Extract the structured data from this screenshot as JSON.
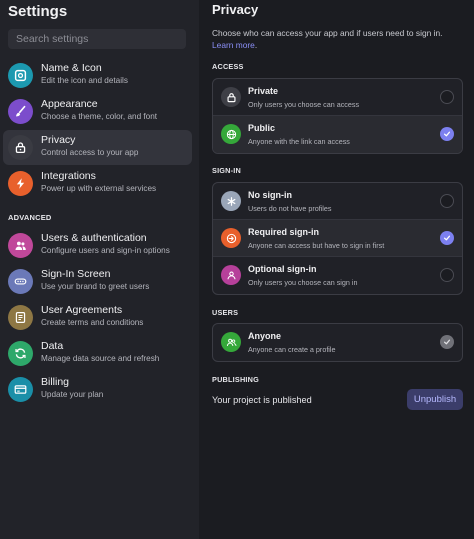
{
  "sidebar": {
    "title": "Settings",
    "search_placeholder": "Search settings",
    "items": [
      {
        "label": "Name & Icon",
        "desc": "Edit the icon and details",
        "icon": "image-icon",
        "color": "#1c99b0"
      },
      {
        "label": "Appearance",
        "desc": "Choose a theme, color, and font",
        "icon": "brush-icon",
        "color": "#7c4dcc"
      },
      {
        "label": "Privacy",
        "desc": "Control access to your app",
        "icon": "lock-icon",
        "color": "#3a3b42"
      },
      {
        "label": "Integrations",
        "desc": "Power up with external services",
        "icon": "bolt-icon",
        "color": "#e8602c"
      }
    ],
    "advanced_label": "ADVANCED",
    "advanced_items": [
      {
        "label": "Users & authentication",
        "desc": "Configure users and sign-in options",
        "icon": "users-icon",
        "color": "#c0489a"
      },
      {
        "label": "Sign-In Screen",
        "desc": "Use your brand to greet users",
        "icon": "signin-screen-icon",
        "color": "#6b79b8"
      },
      {
        "label": "User Agreements",
        "desc": "Create terms and conditions",
        "icon": "document-icon",
        "color": "#8e7744"
      },
      {
        "label": "Data",
        "desc": "Manage data source and refresh",
        "icon": "refresh-icon",
        "color": "#2ea86a"
      },
      {
        "label": "Billing",
        "desc": "Update your plan",
        "icon": "card-icon",
        "color": "#1a8fa8"
      }
    ]
  },
  "main": {
    "title": "Privacy",
    "description": "Choose who can access your app and if users need to sign in. ",
    "learn_more": "Learn more",
    "learn_more_end": ".",
    "access": {
      "heading": "ACCESS",
      "options": [
        {
          "label": "Private",
          "desc": "Only users you choose can access",
          "icon": "lock-icon",
          "color": "#3e3f46",
          "selected": false
        },
        {
          "label": "Public",
          "desc": "Anyone with the link can access",
          "icon": "globe-icon",
          "color": "#35a83a",
          "selected": true
        }
      ]
    },
    "signin": {
      "heading": "SIGN-IN",
      "options": [
        {
          "label": "No sign-in",
          "desc": "Users do not have profiles",
          "icon": "asterisk-icon",
          "color": "#9aa6b8",
          "selected": false
        },
        {
          "label": "Required sign-in",
          "desc": "Anyone can access but have to sign in first",
          "icon": "signin-icon",
          "color": "#e8602c",
          "selected": true
        },
        {
          "label": "Optional sign-in",
          "desc": "Only users you choose can sign in",
          "icon": "user-icon",
          "color": "#b6409a",
          "selected": false
        }
      ]
    },
    "users": {
      "heading": "USERS",
      "options": [
        {
          "label": "Anyone",
          "desc": "Anyone can create a profile",
          "icon": "users-icon",
          "color": "#35a83a",
          "selected": true
        }
      ]
    },
    "publishing": {
      "heading": "PUBLISHING",
      "status": "Your project is published",
      "button": "Unpublish"
    }
  },
  "colors": {
    "accent": "#7c80f0",
    "background": "#1b1c21",
    "sidebar": "#222329"
  }
}
